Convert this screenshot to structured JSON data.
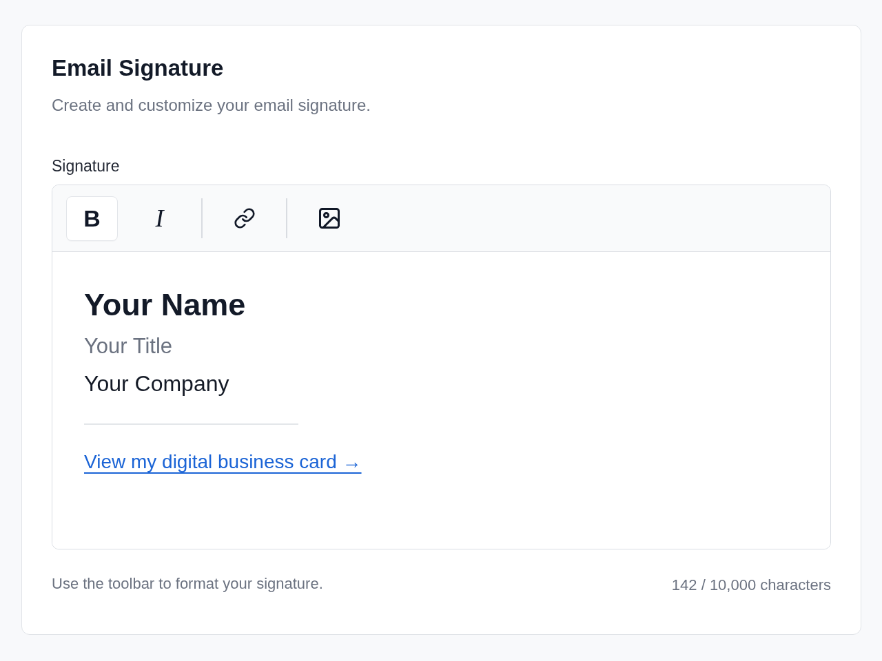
{
  "card": {
    "title": "Email Signature",
    "description": "Create and customize your email signature."
  },
  "editor": {
    "label": "Signature",
    "toolbar": {
      "groups": [
        {
          "tools": [
            {
              "kind": "bold",
              "label": "B",
              "active": true
            },
            {
              "kind": "italic",
              "label": "I",
              "active": false
            }
          ]
        },
        {
          "tools": [
            {
              "kind": "link",
              "active": false
            }
          ]
        },
        {
          "tools": [
            {
              "kind": "image",
              "active": false
            }
          ]
        }
      ]
    },
    "content": {
      "name": "Your Name",
      "title": "Your Title",
      "company": "Your Company",
      "link": "View my digital business card →"
    }
  },
  "footer": {
    "hint": "Use the toolbar to format your signature.",
    "counter": "142 / 10,000 characters"
  }
}
